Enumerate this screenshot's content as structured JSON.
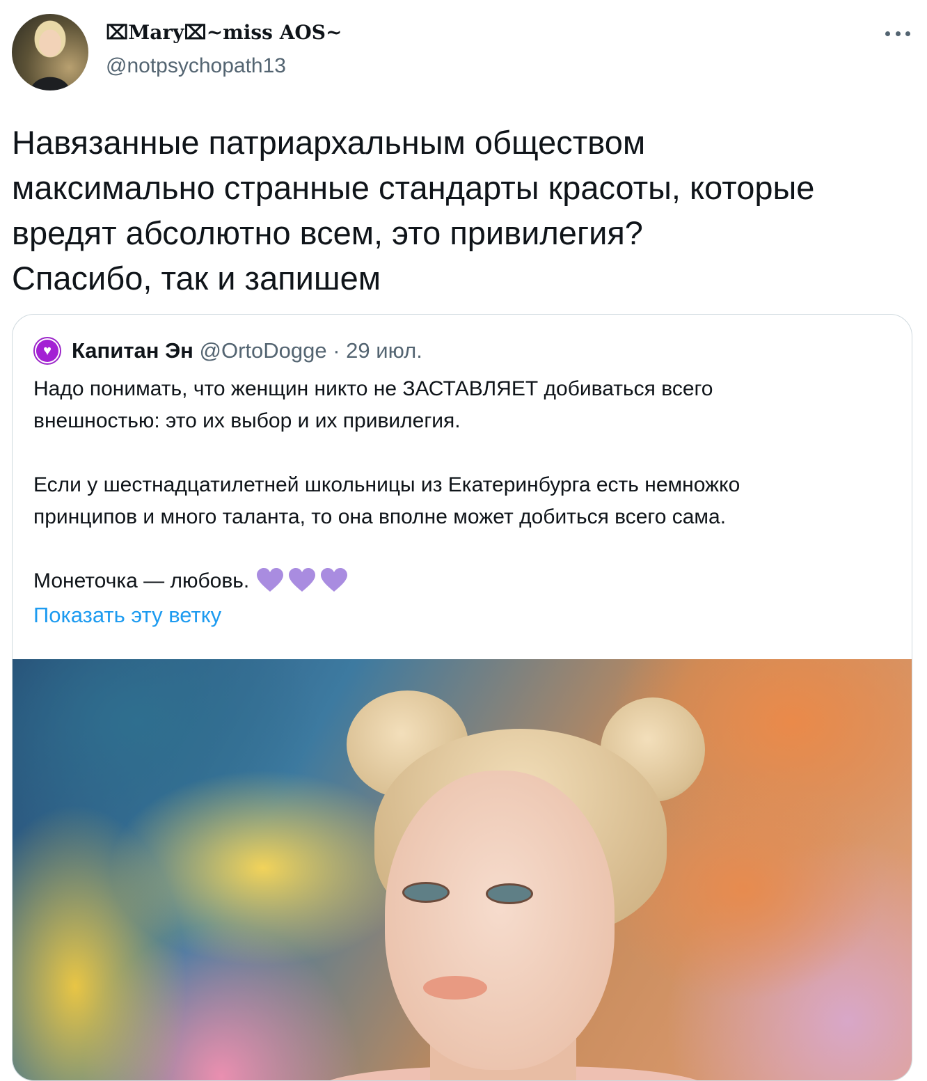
{
  "tweet": {
    "author_name": "⌧Mary⌧~miss AOS~",
    "author_handle": "@notpsychopath13",
    "more_icon": "more-horizontal-icon",
    "text_lines": [
      "Навязанные патриархальным обществом",
      "максимально странные стандарты красоты, которые",
      "вредят абсолютно всем, это привилегия?",
      "Спасибо, так и запишем"
    ]
  },
  "quote": {
    "author_name": "Капитан Эн",
    "author_handle": "@OrtoDogge",
    "separator": "·",
    "date": "29 июл.",
    "avatar_icon": "purple-heart-avatar-icon",
    "paragraphs": [
      [
        "Надо понимать, что женщин никто не ЗАСТАВЛЯЕТ добиваться всего",
        "внешностью: это их выбор и их привилегия."
      ],
      [
        "Если у шестнадцатилетней школьницы из Екатеринбурга есть немножко",
        "принципов и много таланта, то она вполне может добиться всего сама."
      ]
    ],
    "closing_text": "Монеточка — любовь.",
    "emoji_icon": "purple-heart-icon",
    "emoji_count": 3,
    "show_thread_link": "Показать эту ветку",
    "image_subject": "photo-portrait-woman-hair-buns"
  },
  "colors": {
    "text_primary": "#0f1419",
    "text_secondary": "#536471",
    "link": "#1d9bf0",
    "border": "#cfd9de",
    "heart": "#a98ce0",
    "avatar_ring": "#9b26c9"
  }
}
